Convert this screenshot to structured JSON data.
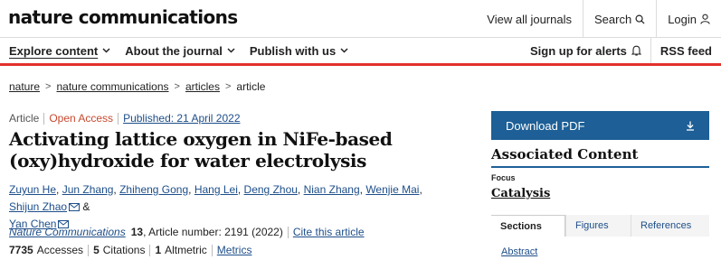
{
  "header": {
    "logo": "nature communications",
    "links": [
      {
        "label": "View all journals",
        "icon": ""
      },
      {
        "label": "Search",
        "icon": "search-icon"
      },
      {
        "label": "Login",
        "icon": "user-icon"
      }
    ]
  },
  "nav": {
    "left": [
      {
        "label": "Explore content",
        "active": true
      },
      {
        "label": "About the journal",
        "active": false
      },
      {
        "label": "Publish with us",
        "active": false
      }
    ],
    "right": [
      {
        "label": "Sign up for alerts",
        "icon": "bell-icon"
      },
      {
        "label": "RSS feed",
        "icon": ""
      }
    ],
    "accent_color": "#e2302b"
  },
  "breadcrumb": {
    "items": [
      "nature",
      "nature communications",
      "articles"
    ],
    "current": "article"
  },
  "article": {
    "type": "Article",
    "access": "Open Access",
    "published": "Published: 21 April 2022",
    "title_line1": "Activating lattice oxygen in NiFe-based",
    "title_line2": "(oxy)hydroxide for water electrolysis",
    "authors": [
      "Zuyun He",
      "Jun Zhang",
      "Zhiheng Gong",
      "Hang Lei",
      "Deng Zhou",
      "Nian Zhang",
      "Wenjie Mai",
      "Shijun Zhao",
      "Yan Chen"
    ],
    "ampersand": "&",
    "journal": "Nature Communications",
    "volume": "13",
    "article_number": ", Article number: 2191 (2022)",
    "cite_label": "Cite this article",
    "accesses": "7735",
    "accesses_label": "Accesses",
    "citations": "5",
    "citations_label": "Citations",
    "altmetric": "1",
    "altmetric_label": "Altmetric",
    "metrics_label": "Metrics"
  },
  "sidebar": {
    "download": "Download PDF",
    "associated": "Associated Content",
    "focus_label": "Focus",
    "focus_item": "Catalysis",
    "tabs": [
      {
        "label": "Sections",
        "active": true
      },
      {
        "label": "Figures",
        "active": false
      },
      {
        "label": "References",
        "active": false
      }
    ],
    "first_section": "Abstract",
    "button_color": "#1d5f96"
  }
}
